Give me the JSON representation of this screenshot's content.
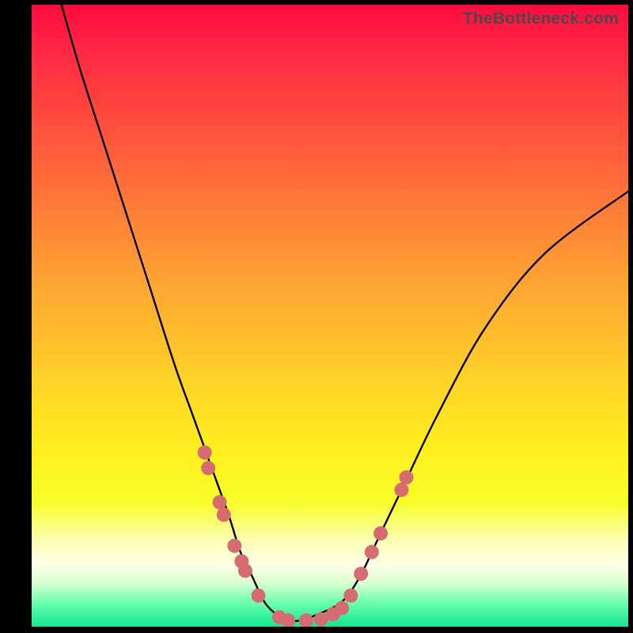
{
  "watermark": "TheBottleneck.com",
  "chart_data": {
    "type": "line",
    "title": "",
    "xlabel": "",
    "ylabel": "",
    "xlim": [
      0,
      100
    ],
    "ylim": [
      0,
      100
    ],
    "series": [
      {
        "name": "curve",
        "x": [
          5,
          8,
          12,
          16,
          20,
          24,
          27,
          30,
          33,
          35,
          37,
          39,
          41,
          43,
          45,
          48,
          52,
          55,
          58,
          62,
          68,
          76,
          86,
          100
        ],
        "y": [
          100,
          90,
          78,
          66,
          54,
          42,
          34,
          26,
          18,
          12,
          8,
          4,
          2,
          1,
          1,
          2,
          4,
          8,
          14,
          22,
          34,
          48,
          60,
          70
        ]
      }
    ],
    "markers": {
      "name": "pink-dots",
      "color": "#d66b72",
      "points": [
        {
          "x": 29.0,
          "y": 28.0
        },
        {
          "x": 29.6,
          "y": 25.5
        },
        {
          "x": 31.5,
          "y": 20.0
        },
        {
          "x": 32.2,
          "y": 18.0
        },
        {
          "x": 34.0,
          "y": 13.0
        },
        {
          "x": 35.2,
          "y": 10.5
        },
        {
          "x": 35.8,
          "y": 9.0
        },
        {
          "x": 38.0,
          "y": 5.0
        },
        {
          "x": 41.5,
          "y": 1.5
        },
        {
          "x": 43.0,
          "y": 1.0
        },
        {
          "x": 46.0,
          "y": 1.0
        },
        {
          "x": 48.5,
          "y": 1.2
        },
        {
          "x": 50.5,
          "y": 2.0
        },
        {
          "x": 52.0,
          "y": 3.0
        },
        {
          "x": 53.5,
          "y": 5.0
        },
        {
          "x": 55.2,
          "y": 8.5
        },
        {
          "x": 57.0,
          "y": 12.0
        },
        {
          "x": 58.5,
          "y": 15.0
        },
        {
          "x": 62.0,
          "y": 22.0
        },
        {
          "x": 62.8,
          "y": 24.0
        }
      ]
    }
  }
}
